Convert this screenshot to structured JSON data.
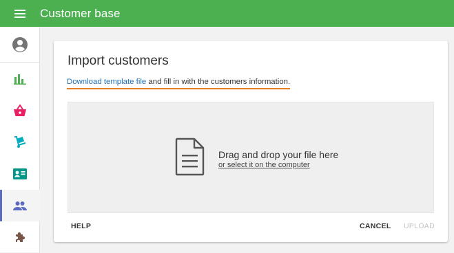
{
  "appbar": {
    "title": "Customer base",
    "menu_icon": "hamburger-menu-icon",
    "color": "#4caf50"
  },
  "sidebar": {
    "items": [
      {
        "name": "account",
        "icon": "account-circle-icon",
        "color": "#757575"
      },
      {
        "name": "reports",
        "icon": "bar-chart-icon",
        "color": "#4caf50"
      },
      {
        "name": "orders",
        "icon": "shopping-basket-icon",
        "color": "#e91e63"
      },
      {
        "name": "shipping",
        "icon": "dolly-icon",
        "color": "#00acc1"
      },
      {
        "name": "contacts",
        "icon": "contact-card-icon",
        "color": "#009688"
      },
      {
        "name": "customers",
        "icon": "people-icon",
        "color": "#5c6bc0",
        "active": true
      },
      {
        "name": "extensions",
        "icon": "puzzle-icon",
        "color": "#795548"
      }
    ]
  },
  "dialog": {
    "title": "Import customers",
    "template_link": "Download template file",
    "instruction_rest": " and fill in with the customers information.",
    "dropzone": {
      "icon": "document-icon",
      "main_text": "Drag and drop your file here",
      "sub_text": "or select it on the computer"
    },
    "actions": {
      "help": "HELP",
      "cancel": "CANCEL",
      "upload": "UPLOAD"
    }
  }
}
